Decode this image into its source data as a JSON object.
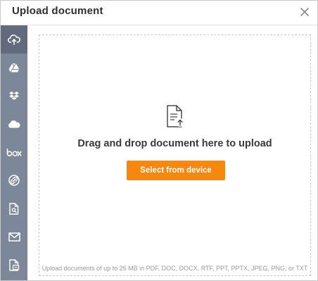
{
  "dialog": {
    "title": "Upload document"
  },
  "sidebar": {
    "items": [
      {
        "name": "upload",
        "icon": "cloud-upload-icon",
        "active": true
      },
      {
        "name": "google-drive",
        "icon": "google-drive-icon",
        "active": false
      },
      {
        "name": "dropbox",
        "icon": "dropbox-icon",
        "active": false
      },
      {
        "name": "onedrive",
        "icon": "onedrive-icon",
        "active": false
      },
      {
        "name": "box",
        "icon": "box-icon",
        "label": "box",
        "active": false
      },
      {
        "name": "link",
        "icon": "link-icon",
        "active": false
      },
      {
        "name": "document-search",
        "icon": "document-search-icon",
        "active": false
      },
      {
        "name": "email",
        "icon": "envelope-icon",
        "active": false
      },
      {
        "name": "templates",
        "icon": "document-template-icon",
        "active": false
      }
    ]
  },
  "dropzone": {
    "icon": "document-upload-icon",
    "text": "Drag and drop document here to upload",
    "button_label": "Select from device",
    "note": "Upload documents of up to 25 MB in PDF, DOC, DOCX, RTF, PPT, PPTX, JPEG, PNG, or TXT"
  },
  "colors": {
    "sidebar": "#7c8799",
    "sidebar_active": "#616b7b",
    "button": "#f6870f"
  }
}
